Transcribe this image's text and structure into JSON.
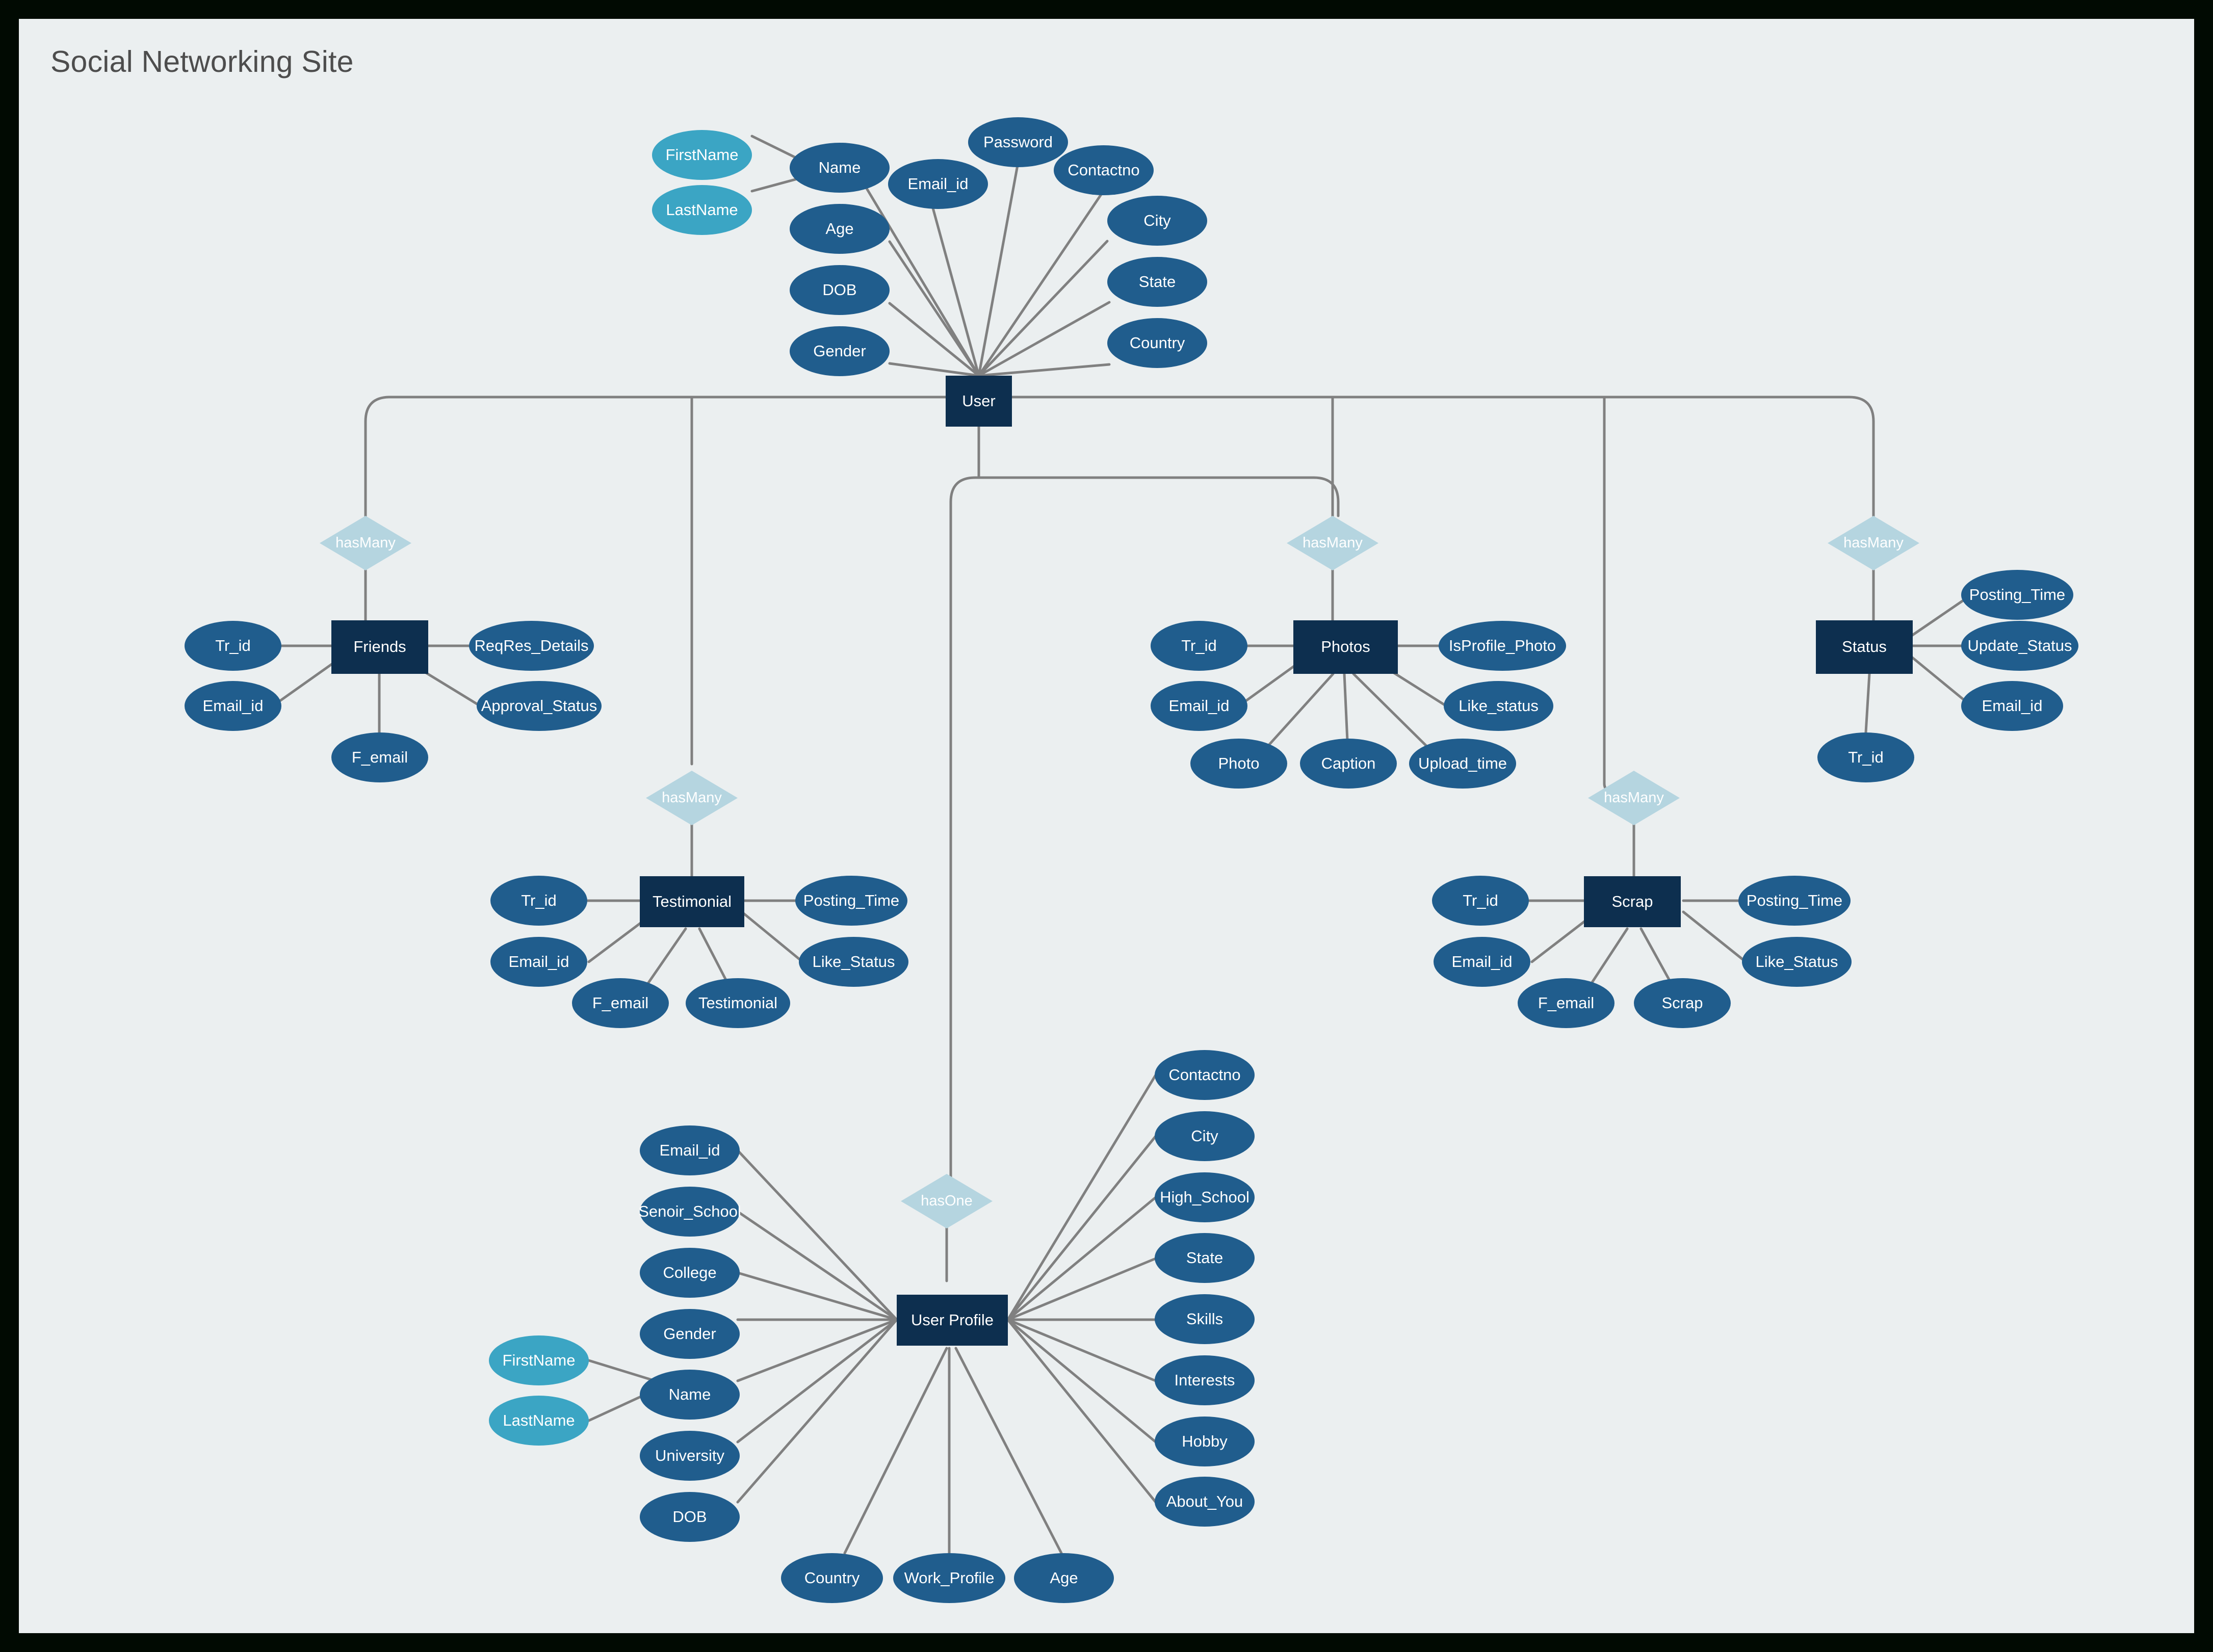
{
  "diagram": {
    "title": "Social Networking Site",
    "type": "er-diagram",
    "colors": {
      "canvas": "#ebeff0",
      "frame": "#010a02",
      "entity": "#0d2f4f",
      "attribute": "#205d8d",
      "sub_attribute": "#3ba5c4",
      "relationship": "#b5d5e0",
      "connector": "#808080",
      "title_text": "#4d4d4d",
      "node_text": "#ffffff"
    },
    "entities": [
      {
        "id": "user",
        "label": "User"
      },
      {
        "id": "friends",
        "label": "Friends"
      },
      {
        "id": "photos",
        "label": "Photos"
      },
      {
        "id": "status",
        "label": "Status"
      },
      {
        "id": "testimonial",
        "label": "Testimonial"
      },
      {
        "id": "scrap",
        "label": "Scrap"
      },
      {
        "id": "user_profile",
        "label": "User Profile"
      }
    ],
    "relationships": [
      {
        "id": "rel_friends",
        "label": "hasMany",
        "from": "User",
        "to": "Friends"
      },
      {
        "id": "rel_photos",
        "label": "hasMany",
        "from": "User",
        "to": "Photos"
      },
      {
        "id": "rel_status",
        "label": "hasMany",
        "from": "User",
        "to": "Status"
      },
      {
        "id": "rel_testimonial",
        "label": "hasMany",
        "from": "User",
        "to": "Testimonial"
      },
      {
        "id": "rel_scrap",
        "label": "hasMany",
        "from": "User",
        "to": "Scrap"
      },
      {
        "id": "rel_profile",
        "label": "hasOne",
        "from": "User",
        "to": "User Profile"
      }
    ],
    "attributes": {
      "user": [
        {
          "id": "u_name",
          "label": "Name"
        },
        {
          "id": "u_age",
          "label": "Age"
        },
        {
          "id": "u_dob",
          "label": "DOB"
        },
        {
          "id": "u_gender",
          "label": "Gender"
        },
        {
          "id": "u_email",
          "label": "Email_id"
        },
        {
          "id": "u_password",
          "label": "Password"
        },
        {
          "id": "u_contactno",
          "label": "Contactno"
        },
        {
          "id": "u_city",
          "label": "City"
        },
        {
          "id": "u_state",
          "label": "State"
        },
        {
          "id": "u_country",
          "label": "Country"
        }
      ],
      "user_sub": [
        {
          "id": "u_firstname",
          "label": "FirstName",
          "parent": "Name"
        },
        {
          "id": "u_lastname",
          "label": "LastName",
          "parent": "Name"
        }
      ],
      "friends": [
        {
          "id": "f_trid",
          "label": "Tr_id"
        },
        {
          "id": "f_email",
          "label": "Email_id"
        },
        {
          "id": "f_femail",
          "label": "F_email"
        },
        {
          "id": "f_reqres",
          "label": "ReqRes_Details"
        },
        {
          "id": "f_approval",
          "label": "Approval_Status"
        }
      ],
      "photos": [
        {
          "id": "p_trid",
          "label": "Tr_id"
        },
        {
          "id": "p_email",
          "label": "Email_id"
        },
        {
          "id": "p_photo",
          "label": "Photo"
        },
        {
          "id": "p_caption",
          "label": "Caption"
        },
        {
          "id": "p_upload",
          "label": "Upload_time"
        },
        {
          "id": "p_isprofile",
          "label": "IsProfile_Photo"
        },
        {
          "id": "p_like",
          "label": "Like_status"
        }
      ],
      "status": [
        {
          "id": "s_posting",
          "label": "Posting_Time"
        },
        {
          "id": "s_update",
          "label": "Update_Status"
        },
        {
          "id": "s_email",
          "label": "Email_id"
        },
        {
          "id": "s_trid",
          "label": "Tr_id"
        }
      ],
      "testimonial": [
        {
          "id": "t_trid",
          "label": "Tr_id"
        },
        {
          "id": "t_email",
          "label": "Email_id"
        },
        {
          "id": "t_femail",
          "label": "F_email"
        },
        {
          "id": "t_testimonial",
          "label": "Testimonial"
        },
        {
          "id": "t_posting",
          "label": "Posting_Time"
        },
        {
          "id": "t_like",
          "label": "Like_Status"
        }
      ],
      "scrap": [
        {
          "id": "sc_trid",
          "label": "Tr_id"
        },
        {
          "id": "sc_email",
          "label": "Email_id"
        },
        {
          "id": "sc_femail",
          "label": "F_email"
        },
        {
          "id": "sc_scrap",
          "label": "Scrap"
        },
        {
          "id": "sc_posting",
          "label": "Posting_Time"
        },
        {
          "id": "sc_like",
          "label": "Like_Status"
        }
      ],
      "user_profile": [
        {
          "id": "up_email",
          "label": "Email_id"
        },
        {
          "id": "up_senior",
          "label": "Senoir_School"
        },
        {
          "id": "up_college",
          "label": "College"
        },
        {
          "id": "up_gender",
          "label": "Gender"
        },
        {
          "id": "up_name",
          "label": "Name"
        },
        {
          "id": "up_university",
          "label": "University"
        },
        {
          "id": "up_dob",
          "label": "DOB"
        },
        {
          "id": "up_contactno",
          "label": "Contactno"
        },
        {
          "id": "up_city",
          "label": "City"
        },
        {
          "id": "up_highschool",
          "label": "High_School"
        },
        {
          "id": "up_state",
          "label": "State"
        },
        {
          "id": "up_skills",
          "label": "Skills"
        },
        {
          "id": "up_interests",
          "label": "Interests"
        },
        {
          "id": "up_hobby",
          "label": "Hobby"
        },
        {
          "id": "up_about",
          "label": "About_You"
        },
        {
          "id": "up_country",
          "label": "Country"
        },
        {
          "id": "up_work",
          "label": "Work_Profile"
        },
        {
          "id": "up_age",
          "label": "Age"
        }
      ],
      "user_profile_sub": [
        {
          "id": "up_firstname",
          "label": "FirstName",
          "parent": "Name"
        },
        {
          "id": "up_lastname",
          "label": "LastName",
          "parent": "Name"
        }
      ]
    }
  }
}
